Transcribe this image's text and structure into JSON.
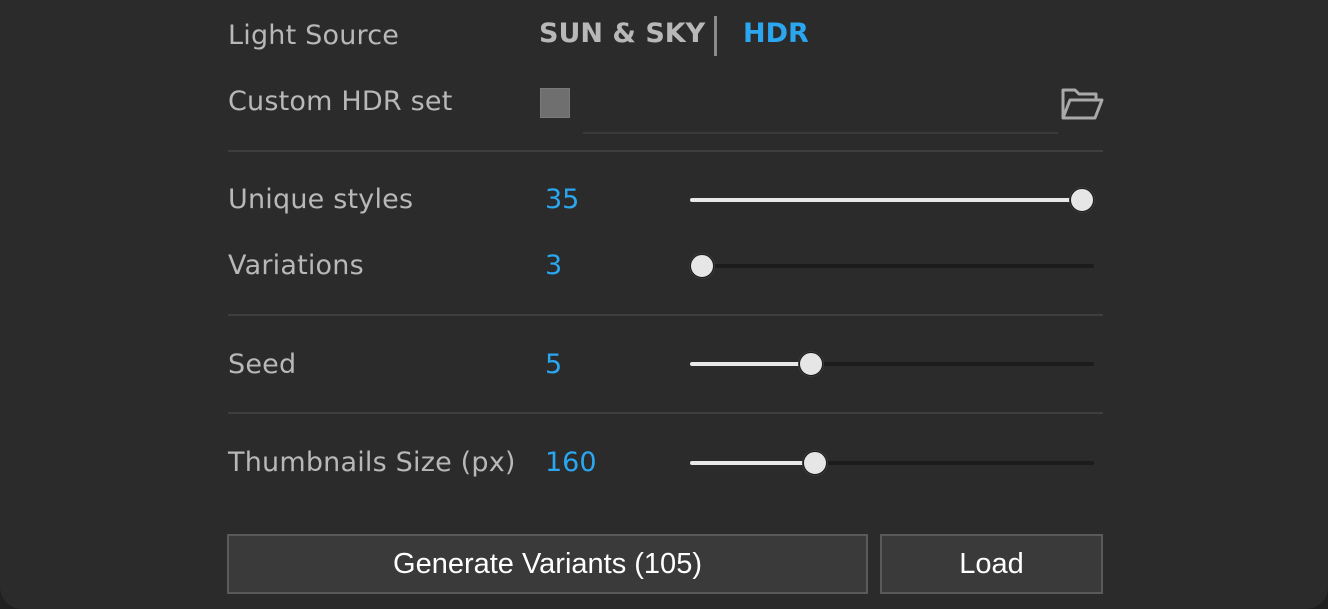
{
  "light_source": {
    "label": "Light Source",
    "tabs": [
      {
        "label": "SUN & SKY",
        "active": false
      },
      {
        "label": "HDR",
        "active": true
      }
    ]
  },
  "custom_hdr": {
    "label": "Custom HDR set",
    "checked": false,
    "path_value": ""
  },
  "sliders": {
    "unique_styles": {
      "label": "Unique styles",
      "value": "35",
      "fraction": 0.97
    },
    "variations": {
      "label": "Variations",
      "value": "3",
      "fraction": 0.03
    },
    "seed": {
      "label": "Seed",
      "value": "5",
      "fraction": 0.3
    },
    "thumbnails_size": {
      "label": "Thumbnails Size (px)",
      "value": "160",
      "fraction": 0.31
    }
  },
  "buttons": {
    "generate": "Generate Variants (105)",
    "load": "Load"
  },
  "colors": {
    "accent": "#2aa7f0",
    "panel": "#2b2b2b",
    "button": "#3a3a3a"
  },
  "icons": {
    "folder": "folder-open-icon"
  }
}
